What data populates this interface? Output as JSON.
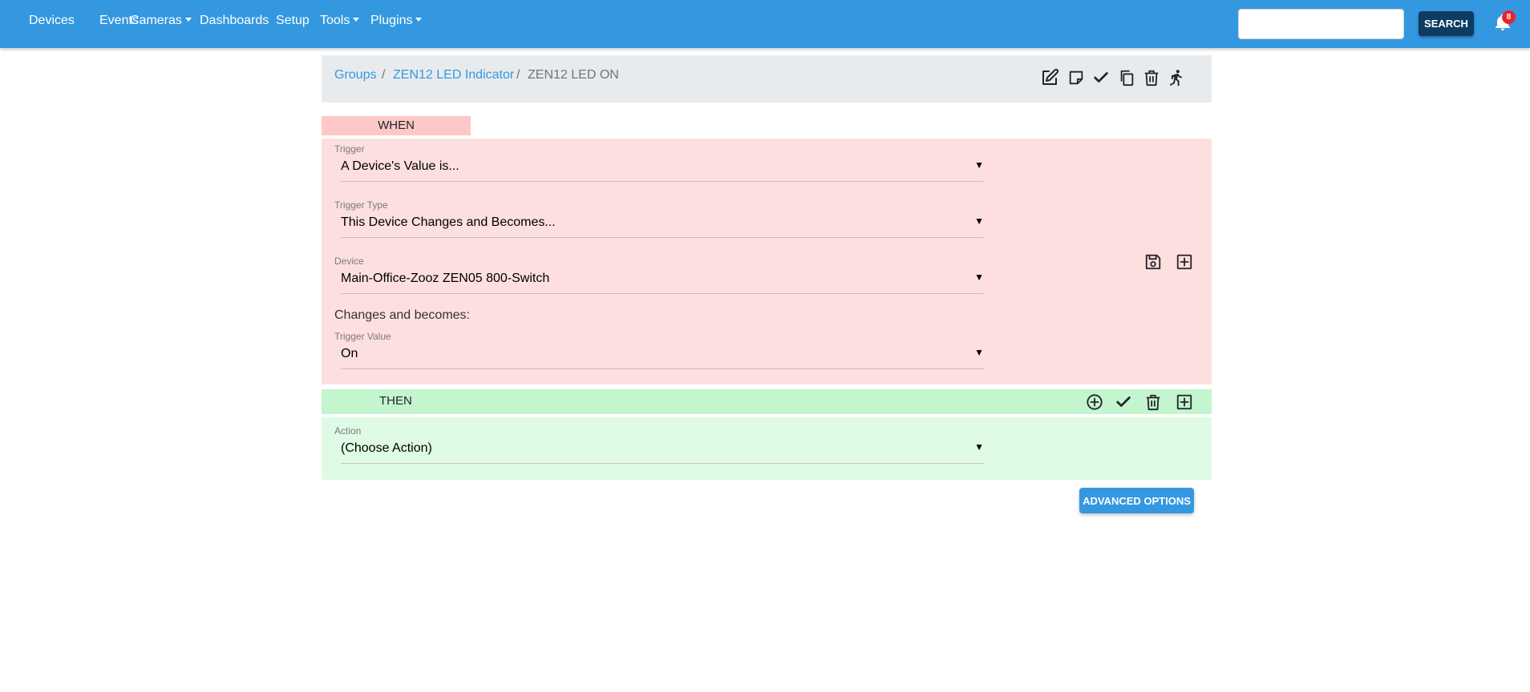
{
  "nav": {
    "items": [
      {
        "label": "Devices",
        "dropdown": false
      },
      {
        "label": "Events",
        "dropdown": false
      },
      {
        "label": "Cameras",
        "dropdown": true
      },
      {
        "label": "Dashboards",
        "dropdown": false
      },
      {
        "label": "Setup",
        "dropdown": false
      },
      {
        "label": "Tools",
        "dropdown": true
      },
      {
        "label": "Plugins",
        "dropdown": true
      }
    ],
    "search_placeholder": "",
    "search_value": "",
    "search_button": "SEARCH",
    "notification_count": "8",
    "bar_color": "#3498e0"
  },
  "breadcrumb": {
    "items": [
      {
        "label": "Groups"
      },
      {
        "label": "ZEN12 LED Indicator"
      },
      {
        "label": "ZEN12 LED ON"
      }
    ],
    "separator": "/"
  },
  "toolbar": {
    "icons": [
      "edit-icon",
      "note-icon",
      "check-icon",
      "copy-icon",
      "trash-icon",
      "run-icon"
    ]
  },
  "when": {
    "label": "WHEN",
    "trigger": {
      "label": "Trigger",
      "value": "A Device's Value is..."
    },
    "trigger_type": {
      "label": "Trigger Type",
      "value": "This Device Changes and Becomes..."
    },
    "device": {
      "label": "Device",
      "value": "Main-Office-Zooz ZEN05 800-Switch"
    },
    "changes_text": "Changes and becomes:",
    "trigger_value": {
      "label": "Trigger Value",
      "value": "On"
    },
    "icons": [
      "save-icon",
      "add-box-icon"
    ],
    "colors": {
      "label_bg": "#fdc8c7",
      "panel_bg": "#fedfdf"
    }
  },
  "then": {
    "label": "THEN",
    "icons": [
      "add-circle-icon",
      "check-icon",
      "trash-icon",
      "add-box-icon"
    ],
    "action": {
      "label": "Action",
      "value": "(Choose Action)"
    },
    "colors": {
      "bar_bg": "#c3f5cf",
      "panel_bg": "#dffbe5"
    }
  },
  "advanced_button": "ADVANCED OPTIONS"
}
